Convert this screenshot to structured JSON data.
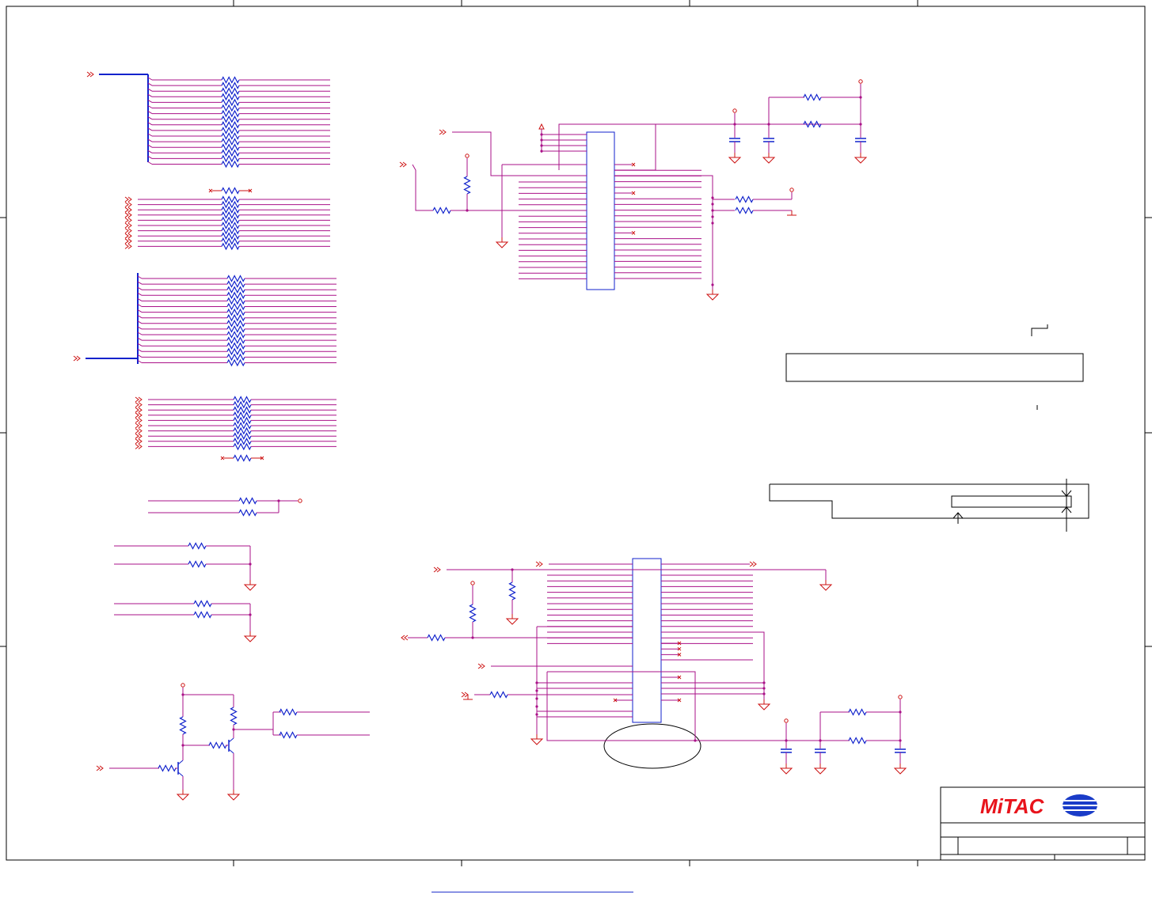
{
  "title_block": {
    "logo_text": "MiTAC",
    "brand_color": "#e8141c",
    "emblem_color": "#1a3cc8"
  },
  "colors": {
    "wire": "#cc1111",
    "bus": "#1122cc",
    "net": "#aa1188",
    "component": "#1122cc",
    "frame": "#000000"
  },
  "icons": {
    "ground": "ground-symbol-icon",
    "power": "power-rail-icon",
    "resistor": "resistor-icon",
    "capacitor": "capacitor-icon",
    "transistor": "npn-transistor-icon",
    "offpage": "offpage-connector-icon",
    "noconnect": "no-connect-icon"
  }
}
